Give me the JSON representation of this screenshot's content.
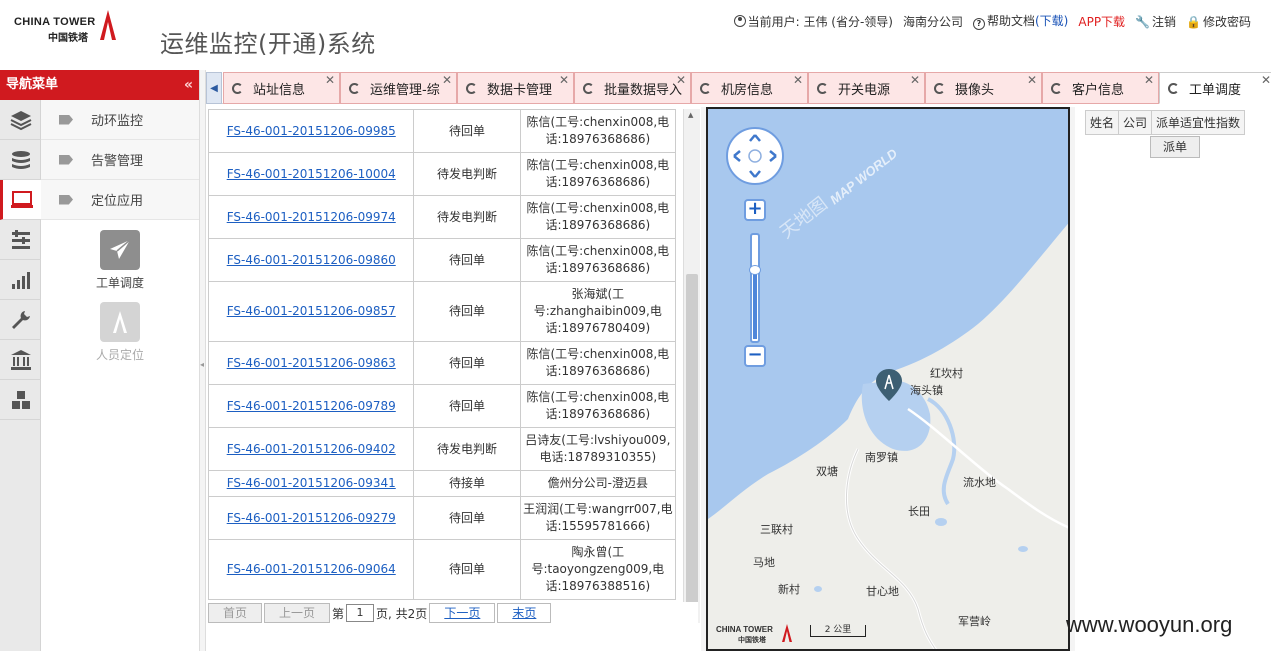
{
  "header": {
    "brand_en": "CHINA TOWER",
    "brand_cn": "中国铁塔",
    "system_title": "运维监控(开通)系统",
    "current_user_label": "当前用户: 王伟 (省分-领导)",
    "branch": "海南分公司",
    "help_label": "帮助文档",
    "download_label": "(下载)",
    "app_download_label": "APP下载",
    "logout_label": "注销",
    "change_password_label": "修改密码"
  },
  "sidebar": {
    "title": "导航菜单",
    "collapse_glyph": "«",
    "icons": [
      "layers-icon",
      "database-icon",
      "monitor-icon",
      "sliders-icon",
      "bar-chart-icon",
      "wrench-icon",
      "bank-icon",
      "boxes-icon"
    ],
    "menu_items": [
      {
        "label": "动环监控"
      },
      {
        "label": "告警管理"
      },
      {
        "label": "定位应用"
      }
    ],
    "tiles": [
      {
        "label": "工单调度",
        "faded": false
      },
      {
        "label": "人员定位",
        "faded": true
      }
    ]
  },
  "tabs": [
    {
      "label": "站址信息"
    },
    {
      "label": "运维管理-综"
    },
    {
      "label": "数据卡管理"
    },
    {
      "label": "批量数据导入"
    },
    {
      "label": "机房信息"
    },
    {
      "label": "开关电源"
    },
    {
      "label": "摄像头"
    },
    {
      "label": "客户信息"
    },
    {
      "label": "工单调度"
    }
  ],
  "active_tab": 8,
  "orders": [
    {
      "id": "FS-46-001-20151206-09985",
      "status": "待回单",
      "person": "陈信(工号:chenxin008,电话:18976368686)"
    },
    {
      "id": "FS-46-001-20151206-10004",
      "status": "待发电判断",
      "person": "陈信(工号:chenxin008,电话:18976368686)"
    },
    {
      "id": "FS-46-001-20151206-09974",
      "status": "待发电判断",
      "person": "陈信(工号:chenxin008,电话:18976368686)"
    },
    {
      "id": "FS-46-001-20151206-09860",
      "status": "待回单",
      "person": "陈信(工号:chenxin008,电话:18976368686)"
    },
    {
      "id": "FS-46-001-20151206-09857",
      "status": "待回单",
      "person": "张海斌(工号:zhanghaibin009,电话:18976780409)"
    },
    {
      "id": "FS-46-001-20151206-09863",
      "status": "待回单",
      "person": "陈信(工号:chenxin008,电话:18976368686)"
    },
    {
      "id": "FS-46-001-20151206-09789",
      "status": "待回单",
      "person": "陈信(工号:chenxin008,电话:18976368686)"
    },
    {
      "id": "FS-46-001-20151206-09402",
      "status": "待发电判断",
      "person": "吕诗友(工号:lvshiyou009,电话:18789310355)"
    },
    {
      "id": "FS-46-001-20151206-09341",
      "status": "待接单",
      "person": "儋州分公司-澄迈县"
    },
    {
      "id": "FS-46-001-20151206-09279",
      "status": "待回单",
      "person": "王润润(工号:wangrr007,电话:15595781666)"
    },
    {
      "id": "FS-46-001-20151206-09064",
      "status": "待回单",
      "person": "陶永曾(工号:taoyongzeng009,电话:18976388516)"
    }
  ],
  "pager": {
    "first": "首页",
    "prev": "上一页",
    "page_prefix": "第",
    "page_value": "1",
    "page_suffix": "页, 共2页",
    "next": "下一页",
    "last": "末页"
  },
  "map": {
    "places": [
      "红坎村",
      "海头镇",
      "南罗镇",
      "双塘",
      "流水地",
      "长田",
      "三联村",
      "马地",
      "新村",
      "甘心地",
      "军营岭"
    ],
    "brand_en": "CHINA TOWER",
    "brand_cn": "中国铁塔",
    "scale_label": "2 公里",
    "watermark_text": "MAP WORLD",
    "watermark_cn": "天地图",
    "colors": {
      "sea": "#a8c8ee",
      "land": "#eeeeea",
      "water": "#b5d0f0"
    }
  },
  "right_table": {
    "headers": [
      "姓名",
      "公司",
      "派单适宜性指数"
    ],
    "dispatch_label": "派单"
  },
  "site_watermark": "www.wooyun.org"
}
